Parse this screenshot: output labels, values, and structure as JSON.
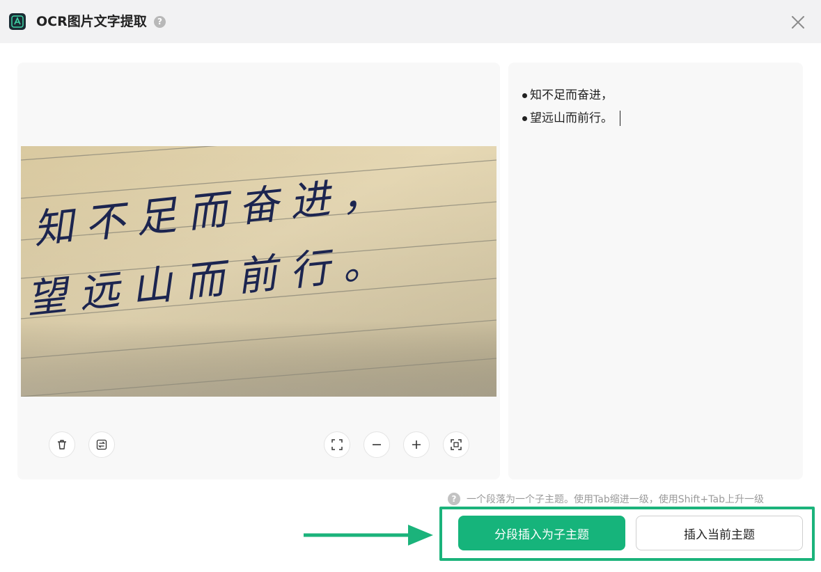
{
  "window": {
    "title": "OCR图片文字提取",
    "help_symbol": "?",
    "logo_icon": "ocr-app-logo-icon",
    "close_icon": "close-icon"
  },
  "image_panel": {
    "image_text_lines": [
      "知不足而奋进，",
      "望远山而前行。"
    ],
    "tools": [
      {
        "name": "delete",
        "icon": "trash-icon"
      },
      {
        "name": "swap",
        "icon": "swap-icon"
      },
      {
        "name": "fit-screen",
        "icon": "fullscreen-icon"
      },
      {
        "name": "zoom-out",
        "icon": "minus-icon"
      },
      {
        "name": "zoom-in",
        "icon": "plus-icon"
      },
      {
        "name": "scan",
        "icon": "scan-icon"
      }
    ]
  },
  "result_panel": {
    "lines": [
      "知不足而奋进，",
      "望远山而前行。"
    ]
  },
  "hint": {
    "icon_symbol": "?",
    "text": "一个段落为一个子主题。使用Tab缩进一级，使用Shift+Tab上升一级"
  },
  "actions": {
    "primary_label": "分段插入为子主题",
    "secondary_label": "插入当前主题"
  },
  "colors": {
    "accent": "#16b47b",
    "highlight": "#1bb37b",
    "titlebar": "#f2f2f3"
  }
}
